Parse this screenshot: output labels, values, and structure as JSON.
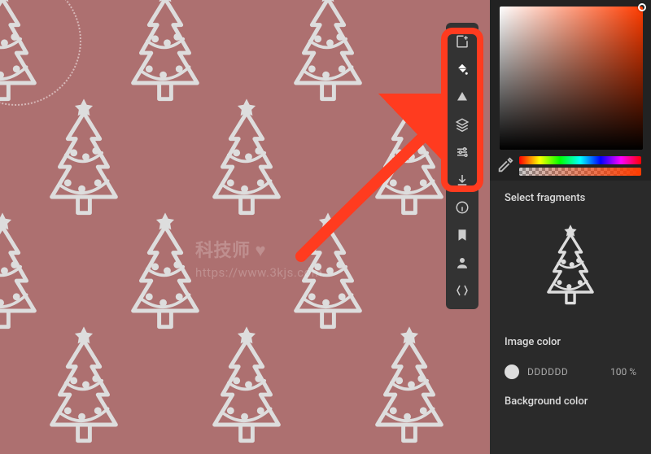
{
  "canvas": {
    "bg_color": "#ad7070"
  },
  "watermark": {
    "line1": "科技师 ♥",
    "line2": "https://www.3kjs.com"
  },
  "panel": {
    "fragments_title": "Select fragments",
    "image_color": {
      "title": "Image color",
      "hex": "DDDDDD",
      "opacity": "100 %",
      "swatch": "#dddddd"
    },
    "background_color": {
      "title": "Background color"
    }
  }
}
